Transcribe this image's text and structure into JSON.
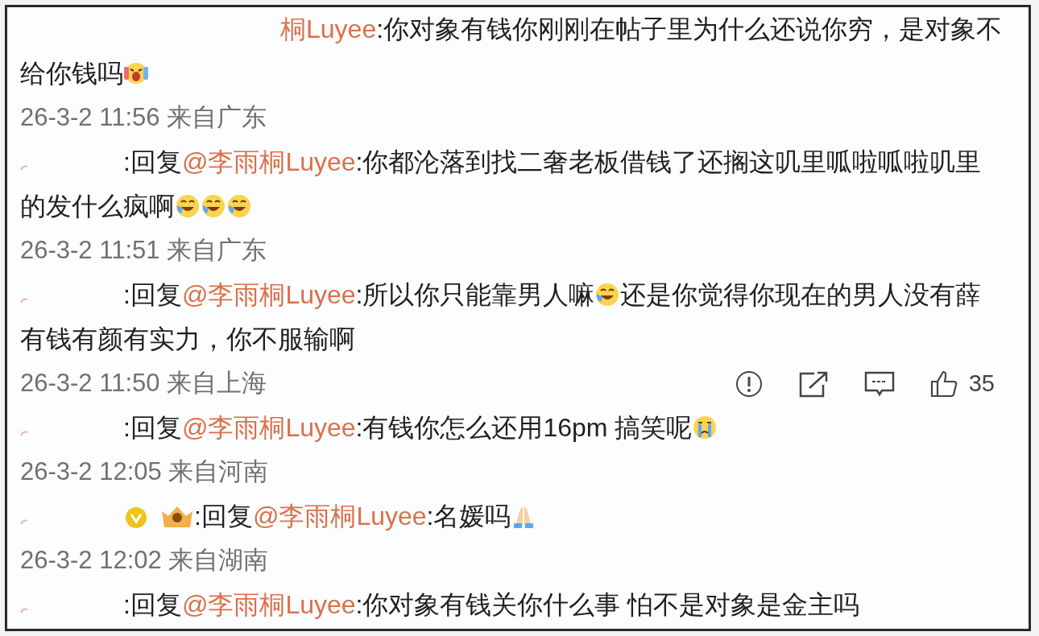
{
  "comments": [
    {
      "indent": true,
      "parts": [
        {
          "kind": "name",
          "text": "桐Luyee"
        },
        {
          "kind": "text",
          "text": ":你对象有钱你刚刚在帖子里为什么还说你穷，是对象不给你钱吗"
        },
        {
          "kind": "scream"
        }
      ],
      "meta": "26-3-2 11:56 来自广东"
    },
    {
      "indent": false,
      "parts": [
        {
          "kind": "redacted"
        },
        {
          "kind": "text",
          "text": ":回复"
        },
        {
          "kind": "mention",
          "text": "@李雨桐Luyee"
        },
        {
          "kind": "text",
          "text": ":你都沦落到找二奢老板借钱了还搁这叽里呱啦呱啦叽里的发什么疯啊"
        },
        {
          "kind": "laughcry"
        },
        {
          "kind": "laughcry"
        },
        {
          "kind": "laughcry"
        }
      ],
      "meta": "26-3-2 11:51 来自广东"
    },
    {
      "indent": false,
      "parts": [
        {
          "kind": "redacted"
        },
        {
          "kind": "text",
          "text": ":回复"
        },
        {
          "kind": "mention",
          "text": "@李雨桐Luyee"
        },
        {
          "kind": "text",
          "text": ":所以你只能靠男人嘛"
        },
        {
          "kind": "laughcry"
        },
        {
          "kind": "text",
          "text": "还是你觉得你现在的男人没有薛有钱有颜有实力，你不服输啊"
        }
      ],
      "meta": "26-3-2 11:50 来自上海",
      "actions": {
        "like_count": "35"
      }
    },
    {
      "indent": false,
      "parts": [
        {
          "kind": "redacted"
        },
        {
          "kind": "text",
          "text": ":回复"
        },
        {
          "kind": "mention",
          "text": "@李雨桐Luyee"
        },
        {
          "kind": "text",
          "text": ":有钱你怎么还用16pm 搞笑呢"
        },
        {
          "kind": "cry"
        }
      ],
      "meta": "26-3-2 12:05 来自河南"
    },
    {
      "indent": false,
      "parts": [
        {
          "kind": "redacted"
        },
        {
          "kind": "verified"
        },
        {
          "kind": "crown"
        },
        {
          "kind": "text",
          "text": ":回复"
        },
        {
          "kind": "mention",
          "text": "@李雨桐Luyee"
        },
        {
          "kind": "text",
          "text": ":名媛吗"
        },
        {
          "kind": "pray"
        }
      ],
      "meta": "26-3-2 12:02 来自湖南"
    },
    {
      "indent": false,
      "parts": [
        {
          "kind": "redacted"
        },
        {
          "kind": "text",
          "text": ":回复"
        },
        {
          "kind": "mention",
          "text": "@李雨桐Luyee"
        },
        {
          "kind": "text",
          "text": ":你对象有钱关你什么事 怕不是对象是金主吗"
        }
      ]
    }
  ]
}
